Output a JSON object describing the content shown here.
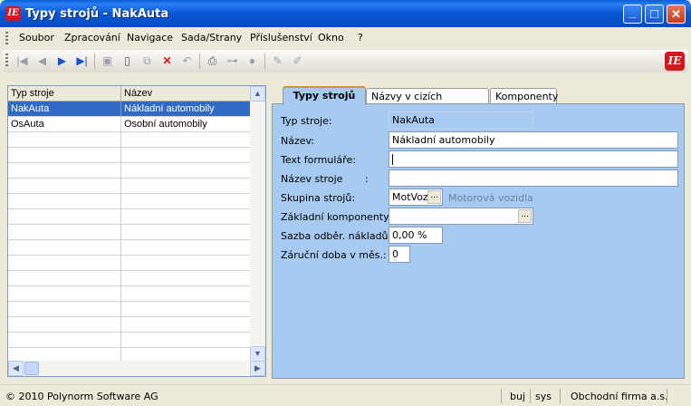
{
  "window": {
    "title": "Typy strojů - NakAuta",
    "app_icon_text": "IE",
    "minimize_glyph": "_",
    "maximize_glyph": "□",
    "close_glyph": "✕"
  },
  "menu": [
    "Soubor",
    "Zpracování",
    "Navigace",
    "Sada/Strany",
    "Příslušenství",
    "Okno",
    "?"
  ],
  "toolbar": {
    "icons": [
      "first-record-icon",
      "previous-record-icon",
      "next-record-icon",
      "last-record-icon",
      "save-icon",
      "new-document-icon",
      "copy-icon",
      "delete-icon",
      "undo-icon",
      "print-icon",
      "tree-icon",
      "help-icon",
      "edit-icon",
      "edit-alt-icon",
      "app-logo-icon"
    ],
    "delete_color": "#e0101a",
    "nav_color": "#1b52c8",
    "logo_text": "IE"
  },
  "grid": {
    "columns": [
      "Typ stroje",
      "Název"
    ],
    "rows": [
      {
        "code": "NakAuta",
        "name": "Nákladní automobily",
        "selected": true
      },
      {
        "code": "OsAuta",
        "name": "Osobní automobily",
        "selected": false
      }
    ],
    "selection_color": "#316ac5"
  },
  "tabs": [
    "Typy strojů",
    "Názvy v cizích jazycích",
    "Komponenty"
  ],
  "active_tab": "Typy strojů",
  "form": {
    "typ_stroje": {
      "label": "Typ stroje:",
      "value": "NakAuta"
    },
    "nazev": {
      "label": "Název:",
      "value": "Nákladní automobily"
    },
    "text_formulare": {
      "label": "Text formuláře:",
      "value": ""
    },
    "nazev_stroje": {
      "label": "Název stroje       :",
      "value": ""
    },
    "skupina_stroju": {
      "label": "Skupina strojů:",
      "value": "MotVoz",
      "description": "Motorová vozidla"
    },
    "zakladni_komponenty": {
      "label": "Základní komponenty:",
      "value": ""
    },
    "sazba": {
      "label": "Sazba odběr. nákladů:",
      "value": "0,00 %"
    },
    "zarucni_doba": {
      "label": "Záruční doba v měs.:",
      "value": "0"
    },
    "ellipsis": "..."
  },
  "status": {
    "copyright": "© 2010 Polynorm Software AG",
    "user": "buj",
    "system": "sys",
    "company": "Obchodní firma a.s."
  },
  "colors": {
    "titlebar": "#0857d6",
    "panel": "#a6caf0",
    "tab_accent": "#e68b2c"
  }
}
